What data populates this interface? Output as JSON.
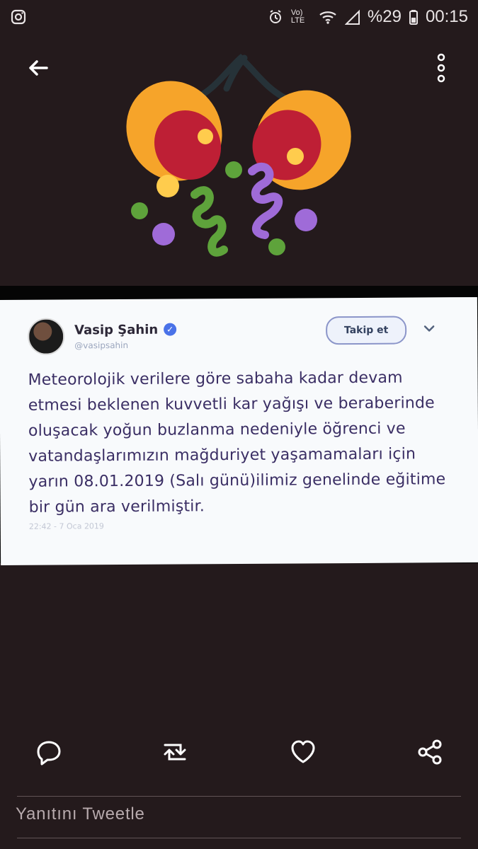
{
  "status_bar": {
    "left_icon": "instagram-icon",
    "network": "Vo) LTE",
    "battery": "%29",
    "time": "00:15"
  },
  "actions": {
    "back_icon": "back-arrow-icon",
    "more_icon": "more-vertical-icon"
  },
  "tweet": {
    "author_name": "Vasip Şahin",
    "author_handle": "@vasipsahin",
    "follow_label": "Takip et",
    "text": "Meteorolojik verilere göre sabaha kadar devam etmesi beklenen kuvvetli kar yağışı ve beraberinde oluşacak yoğun buzlanma nedeniyle öğrenci ve vatandaşlarımızın mağduriyet yaşamamaları için yarın 08.01.2019 (Salı günü)ilimiz genelinde eğitime bir gün ara verilmiştir.",
    "timestamp": "22:42 - 7 Oca 2019"
  },
  "bottom_actions": {
    "reply_icon": "reply-icon",
    "retweet_icon": "retweet-icon",
    "like_icon": "heart-icon",
    "share_icon": "share-icon"
  },
  "reply_placeholder": "Yanıtını Tweetle",
  "colors": {
    "background": "#241a1c",
    "tweet_text": "#3a2e64",
    "confetti_orange": "#f6a42a",
    "confetti_red": "#be1f35",
    "confetti_yellow": "#ffcc4d",
    "confetti_green": "#5ea33b",
    "confetti_purple": "#9f6bd8"
  }
}
